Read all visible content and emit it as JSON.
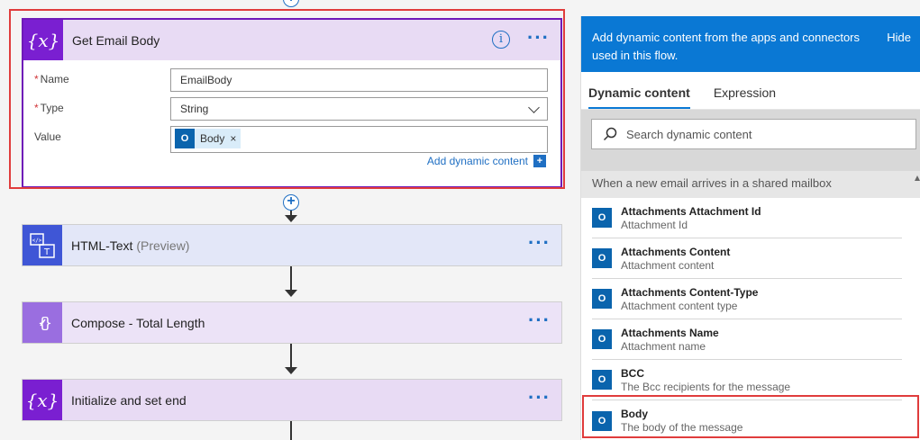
{
  "actions": {
    "get_email_body": {
      "title": "Get Email Body",
      "icon": "variable-icon",
      "fields": {
        "name_label": "Name",
        "name_value": "EmailBody",
        "type_label": "Type",
        "type_value": "String",
        "value_label": "Value",
        "value_token": "Body"
      },
      "add_dynamic_label": "Add dynamic content"
    },
    "html_text": {
      "title": "HTML-Text",
      "suffix": "(Preview)",
      "icon": "html-to-text-icon"
    },
    "compose": {
      "title": "Compose - Total Length",
      "icon": "compose-icon"
    },
    "init_set_end": {
      "title": "Initialize and set end",
      "icon": "variable-icon"
    }
  },
  "panel": {
    "header": "Add dynamic content from the apps and connectors used in this flow.",
    "hide_label": "Hide",
    "tabs": [
      {
        "label": "Dynamic content",
        "active": true
      },
      {
        "label": "Expression",
        "active": false
      }
    ],
    "search_placeholder": "Search dynamic content",
    "section_title": "When a new email arrives in a shared mailbox",
    "items": [
      {
        "title": "Attachments Attachment Id",
        "desc": "Attachment Id"
      },
      {
        "title": "Attachments Content",
        "desc": "Attachment content"
      },
      {
        "title": "Attachments Content-Type",
        "desc": "Attachment content type"
      },
      {
        "title": "Attachments Name",
        "desc": "Attachment name"
      },
      {
        "title": "BCC",
        "desc": "The Bcc recipients for the message"
      },
      {
        "title": "Body",
        "desc": "The body of the message"
      }
    ]
  },
  "colors": {
    "variable_accent": "#7a1fd1",
    "html_accent": "#3f56d6",
    "compose_accent": "#9a6ee0",
    "panel_header": "#0a78d4",
    "highlight_outline": "#e03c3c",
    "outlook_blue": "#0a64ad"
  }
}
